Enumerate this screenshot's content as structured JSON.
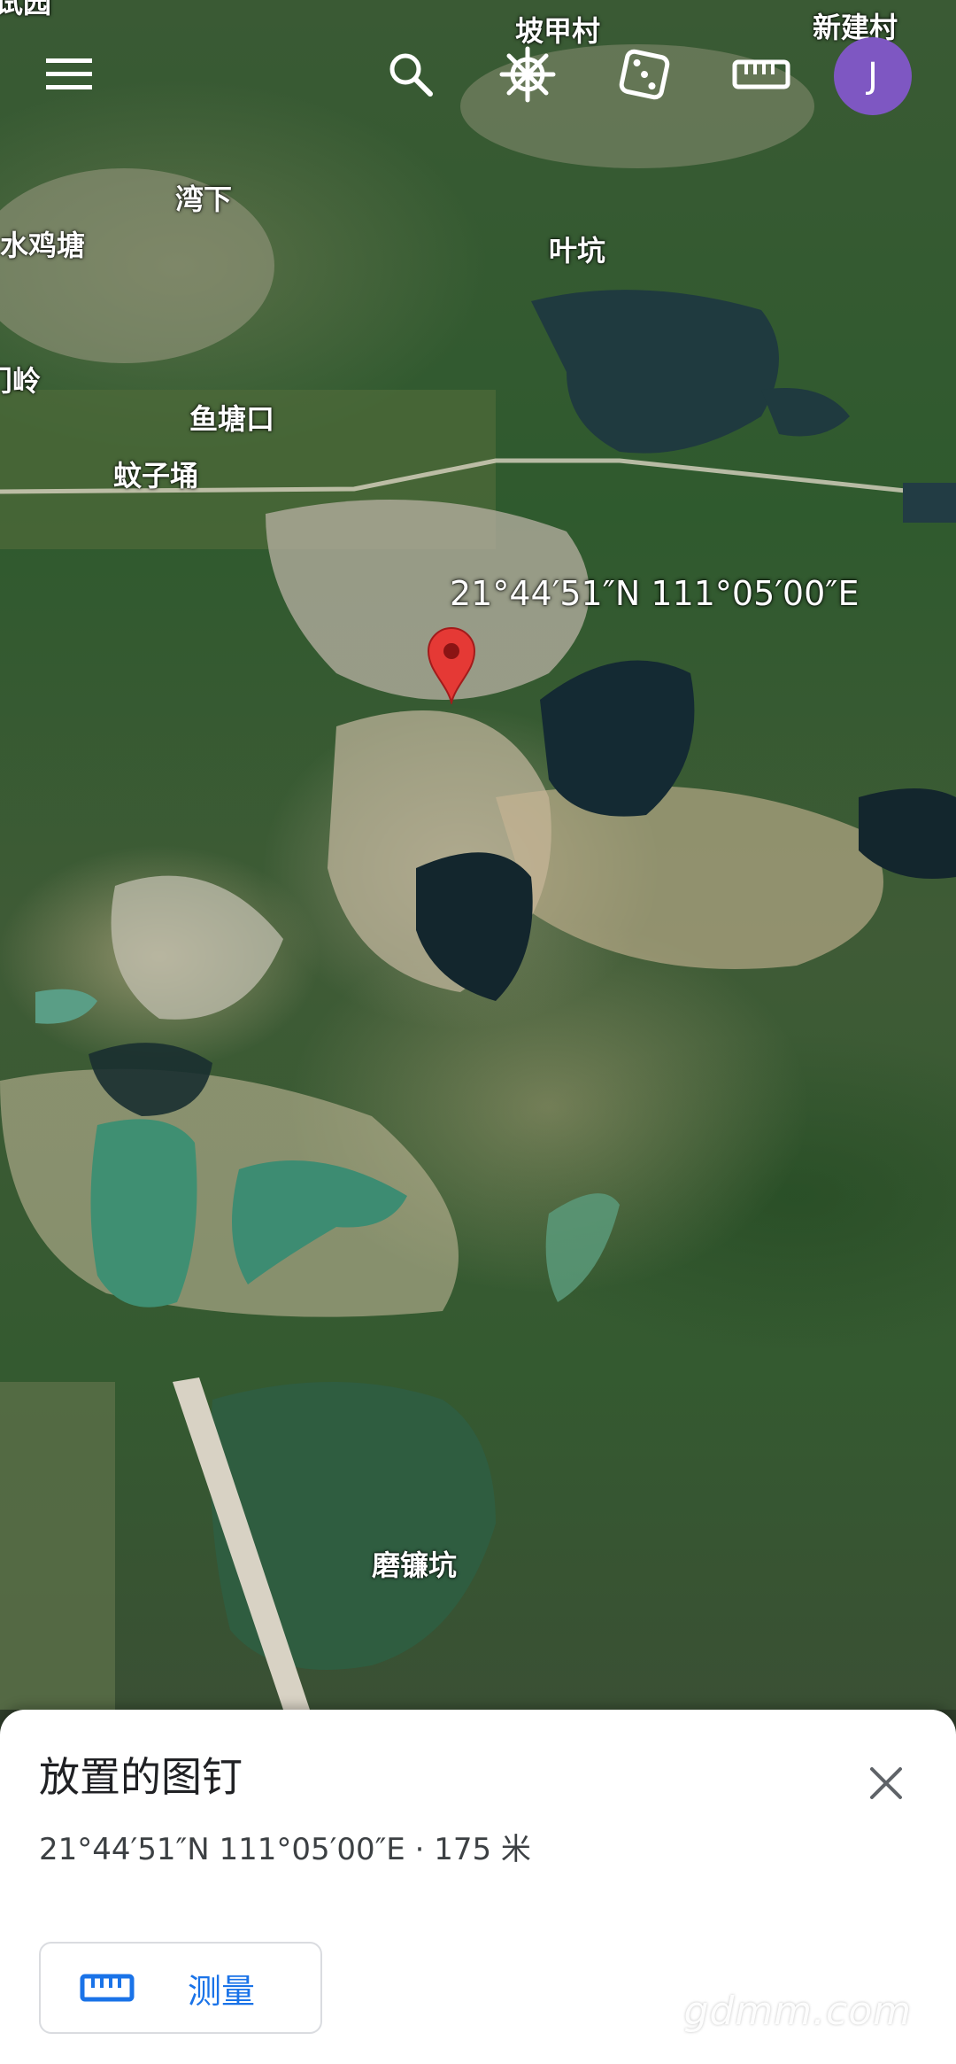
{
  "map": {
    "labels": {
      "top_left_partial": "试园",
      "pojia": "坡甲村",
      "xinjian": "新建村",
      "wanxia": "湾下",
      "shuiji": "水鸡塘",
      "yekeng": "叶坑",
      "ling": "门岭",
      "yutang": "鱼塘口",
      "wenzi": "蚊子埇",
      "molian": "磨镰坑"
    },
    "pin_coordinate": "21°44′51″N 111°05′00″E"
  },
  "topbar": {
    "icons": [
      "menu-icon",
      "search-icon",
      "ship-wheel-icon",
      "dice-icon",
      "ruler-icon"
    ],
    "avatar_letter": "J"
  },
  "sheet": {
    "title": "放置的图钉",
    "subtitle": "21°44′51″N 111°05′00″E · 175 米",
    "measure_label": "测量"
  },
  "watermark": "gdmm.com",
  "colors": {
    "avatar": "#7e57c2",
    "accent": "#1a73e8",
    "pin": "#e53935"
  }
}
